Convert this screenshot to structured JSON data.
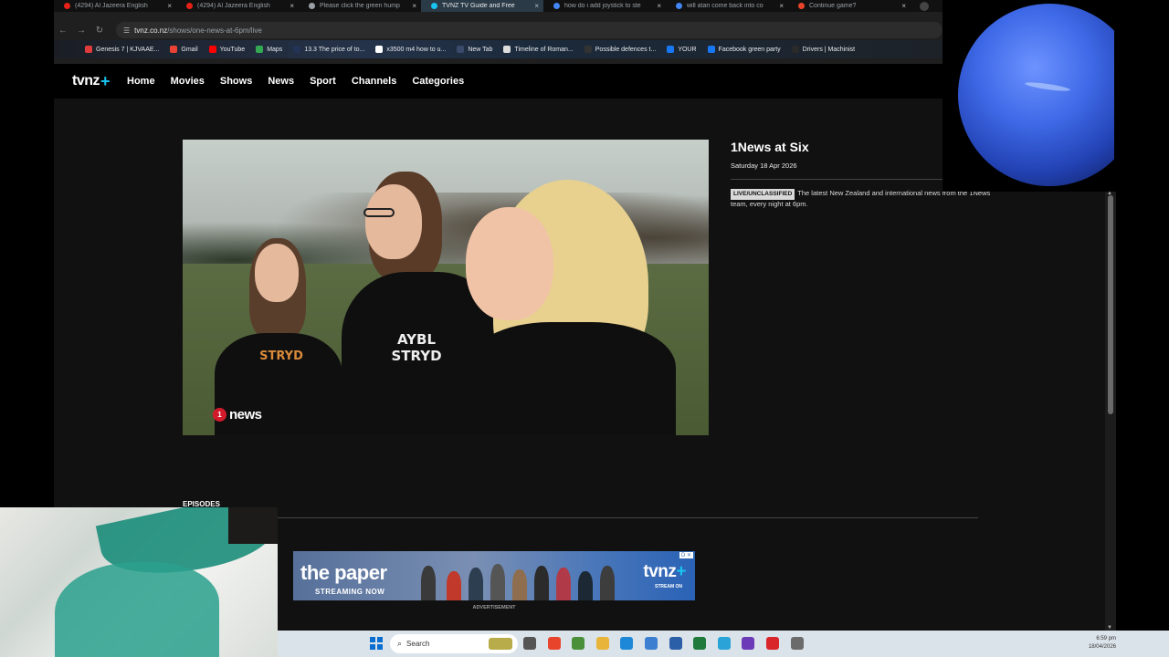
{
  "tabs": [
    {
      "title": "(4294) Al Jazeera English",
      "color": "#e62117",
      "active": false
    },
    {
      "title": "(4294) Al Jazeera English",
      "color": "#e62117",
      "active": false
    },
    {
      "title": "Please click the green hump",
      "color": "#9aa0a6",
      "active": false
    },
    {
      "title": "TVNZ TV Guide and Free",
      "color": "#19c3f0",
      "active": true
    },
    {
      "title": "how do i add joystick to ste",
      "color": "#4285f4",
      "active": false
    },
    {
      "title": "will atari come back into co",
      "color": "#4285f4",
      "active": false
    },
    {
      "title": "Continue game?",
      "color": "#e8442b",
      "active": false
    }
  ],
  "toolbar": {
    "back": "←",
    "forward": "→",
    "reload": "↻",
    "url_host": "tvnz.co.nz",
    "url_path": "/shows/one-news-at-6pm/live"
  },
  "bookmarks": [
    {
      "label": "Genesis 7 | KJVAAE...",
      "color": "#e23b3b"
    },
    {
      "label": "Gmail",
      "color": "#ea4335"
    },
    {
      "label": "YouTube",
      "color": "#ff0000"
    },
    {
      "label": "Maps",
      "color": "#34a853"
    },
    {
      "label": "13.3 The price of to...",
      "color": "#223355"
    },
    {
      "label": "x3500 m4 how to u...",
      "color": "#ffffff"
    },
    {
      "label": "New Tab",
      "color": "#3a4a6a"
    },
    {
      "label": "Timeline of Roman...",
      "color": "#dddddd"
    },
    {
      "label": "Possible defences t...",
      "color": "#333333"
    },
    {
      "label": "YOUR",
      "color": "#1877f2"
    },
    {
      "label": "Facebook green party",
      "color": "#1877f2"
    },
    {
      "label": "Drivers | Machinist",
      "color": "#2a2a2a"
    }
  ],
  "site": {
    "logo": "tvnz",
    "logo_plus": "+",
    "nav": [
      "Home",
      "Movies",
      "Shows",
      "News",
      "Sport",
      "Channels",
      "Categories"
    ]
  },
  "player": {
    "channel_badge": "1",
    "channel_word": "news",
    "shirt_left": "STRYD",
    "shirt_mid_top": "AYBL",
    "shirt_mid_bottom": "STRYD"
  },
  "show": {
    "title": "1News at Six",
    "date": "Saturday 18 Apr 2026",
    "badge": "LIVE/UNCLASSIFIED",
    "description": "The latest New Zealand and international news from the 1News team, every night at 6pm."
  },
  "episodes_label": "EPISODES",
  "ad": {
    "headline": "the paper",
    "sub": "STREAMING NOW",
    "brand": "tvnz",
    "brand_plus": "+",
    "brand_sub": "STREAM ON",
    "choice": "D ✕",
    "label": "ADVERTISEMENT"
  },
  "taskbar": {
    "search": "Search",
    "time": "6:59 pm",
    "date": "18/04/2026",
    "apps": [
      {
        "name": "file-explorer-app-icon",
        "color": "#555555"
      },
      {
        "name": "chrome-app-icon",
        "color": "#e8442b"
      },
      {
        "name": "app-icon-green",
        "color": "#4a8f3a"
      },
      {
        "name": "folder-app-icon",
        "color": "#e8b43a"
      },
      {
        "name": "edge-app-icon",
        "color": "#1e88d8"
      },
      {
        "name": "app-icon-blue",
        "color": "#3c7fd1"
      },
      {
        "name": "app-icon-grid",
        "color": "#2b5fa8"
      },
      {
        "name": "app-icon-green-dark",
        "color": "#1f7a3b"
      },
      {
        "name": "telegram-app-icon",
        "color": "#2aa3d8"
      },
      {
        "name": "app-icon-purple",
        "color": "#6b3bb8"
      },
      {
        "name": "app-icon-red",
        "color": "#d8262a"
      },
      {
        "name": "settings-app-icon",
        "color": "#6b6b6b"
      }
    ]
  }
}
